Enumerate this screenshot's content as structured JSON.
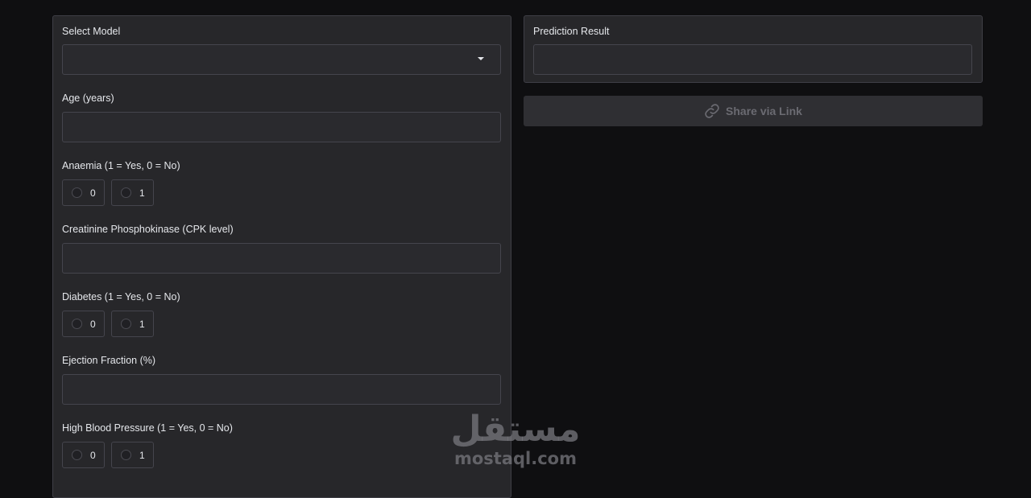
{
  "form": {
    "model": {
      "label": "Select Model",
      "value": ""
    },
    "age": {
      "label": "Age (years)",
      "value": ""
    },
    "anaemia": {
      "label": "Anaemia (1 = Yes, 0 = No)",
      "options": [
        "0",
        "1"
      ]
    },
    "cpk": {
      "label": "Creatinine Phosphokinase (CPK level)",
      "value": ""
    },
    "diabetes": {
      "label": "Diabetes (1 = Yes, 0 = No)",
      "options": [
        "0",
        "1"
      ]
    },
    "ejection": {
      "label": "Ejection Fraction (%)",
      "value": ""
    },
    "hbp": {
      "label": "High Blood Pressure (1 = Yes, 0 = No)",
      "options": [
        "0",
        "1"
      ]
    }
  },
  "result": {
    "label": "Prediction Result",
    "value": ""
  },
  "share": {
    "label": "Share via Link",
    "icon": "link-icon"
  },
  "watermark": {
    "arabic": "مستقل",
    "latin": "mostaql.com"
  },
  "colors": {
    "background": "#0f0f11",
    "panel": "#27272a",
    "border": "#3f3f46",
    "text": "#e5e7eb",
    "muted": "#6b6b72"
  }
}
